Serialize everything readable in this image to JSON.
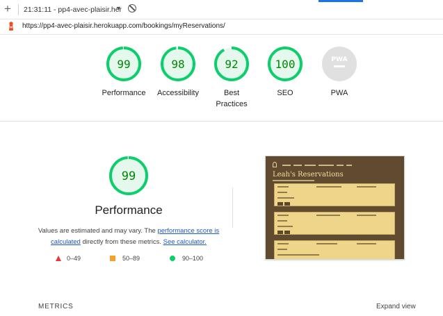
{
  "browser": {
    "tab_title": "21:31:11 - pp4-avec-plaisir.her",
    "url": "https://pp4-avec-plaisir.herokuapp.com/bookings/myReservations/"
  },
  "gauges": [
    {
      "score": "99",
      "label": "Performance",
      "fraction": 0.99
    },
    {
      "score": "98",
      "label": "Accessibility",
      "fraction": 0.98
    },
    {
      "score": "92",
      "label": "Best Practices",
      "fraction": 0.92
    },
    {
      "score": "100",
      "label": "SEO",
      "fraction": 1.0
    },
    {
      "score": "PWA",
      "label": "PWA"
    }
  ],
  "performance": {
    "score": "99",
    "title": "Performance",
    "desc_pre": "Values are estimated and may vary. The ",
    "desc_link1": "performance score is calculated",
    "desc_mid": " directly from these metrics. ",
    "desc_link2": "See calculator.",
    "fraction": 0.99
  },
  "legend": {
    "fail": "0–49",
    "average": "50–89",
    "pass": "90–100"
  },
  "thumbnail": {
    "heading": "Leah's Reservations"
  },
  "footer": {
    "metrics_label": "METRICS",
    "expand_label": "Expand view"
  },
  "colors": {
    "pass_green": "#0cce6b",
    "pass_fill": "#e5f8ee",
    "pass_text": "#008800",
    "pwa_grey": "#e0e0e0",
    "link": "#1a56c8",
    "fail_red": "#e53935",
    "average_orange": "#f4a12a"
  }
}
